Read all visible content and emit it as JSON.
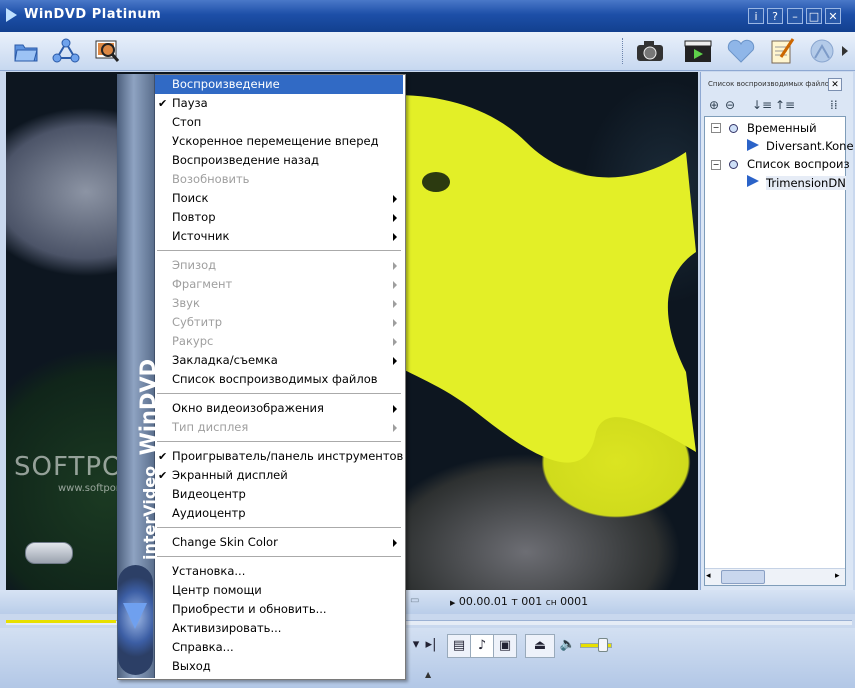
{
  "window": {
    "title": "WinDVD Platinum",
    "controls": [
      "i",
      "?",
      "–",
      "□",
      "✕"
    ]
  },
  "toolbar": {
    "left": [
      "open-icon",
      "network-icon",
      "search-icon"
    ],
    "right": [
      "camera-icon",
      "clapper-icon",
      "heart-icon",
      "notepad-icon",
      "satellite-icon"
    ]
  },
  "watermark": {
    "text": "SOFTPORTAL",
    "url": "www.softportal.com"
  },
  "playlist": {
    "title": "Список воспроизводимых файлов",
    "nodes": [
      {
        "label": "Временный",
        "level": 0
      },
      {
        "label": "Diversant.Kone",
        "level": 1
      },
      {
        "label": "Список воспроиз",
        "level": 0
      },
      {
        "label": "TrimensionDN",
        "level": 1
      }
    ]
  },
  "status": {
    "time": "00.00.01",
    "title_prefix": "т",
    "title_num": "001",
    "chapter_prefix": "сн",
    "chapter_num": "0001"
  },
  "menu": {
    "side_brand": "WinDVD",
    "side_vendor": "interVideo",
    "items": [
      {
        "label": "Воспроизведение",
        "highlight": true
      },
      {
        "label": "Пауза",
        "checked": true
      },
      {
        "label": "Стоп"
      },
      {
        "label": "Ускоренное перемещение вперед"
      },
      {
        "label": "Воспроизведение назад"
      },
      {
        "label": "Возобновить",
        "disabled": true
      },
      {
        "label": "Поиск",
        "submenu": true
      },
      {
        "label": "Повтор",
        "submenu": true
      },
      {
        "label": "Источник",
        "submenu": true
      },
      {
        "separator": true
      },
      {
        "label": "Эпизод",
        "disabled": true,
        "submenu": true
      },
      {
        "label": "Фрагмент",
        "disabled": true,
        "submenu": true
      },
      {
        "label": "Звук",
        "disabled": true,
        "submenu": true
      },
      {
        "label": "Субтитр",
        "disabled": true,
        "submenu": true
      },
      {
        "label": "Ракурс",
        "disabled": true,
        "submenu": true
      },
      {
        "label": "Закладка/съемка",
        "submenu": true
      },
      {
        "label": "Список воспроизводимых файлов"
      },
      {
        "separator": true
      },
      {
        "label": "Окно видеоизображения",
        "submenu": true
      },
      {
        "label": "Тип дисплея",
        "disabled": true,
        "submenu": true
      },
      {
        "separator": true
      },
      {
        "label": "Проигрыватель/панель инструментов",
        "checked": true
      },
      {
        "label": "Экранный дисплей",
        "checked": true
      },
      {
        "label": "Видеоцентр"
      },
      {
        "label": "Аудиоцентр"
      },
      {
        "separator": true
      },
      {
        "label": "Change Skin Color",
        "submenu": true
      },
      {
        "separator": true
      },
      {
        "label": "Установка..."
      },
      {
        "label": "Центр помощи"
      },
      {
        "label": "Приобрести и обновить..."
      },
      {
        "label": "Активизировать..."
      },
      {
        "label": "Справка..."
      },
      {
        "label": "Выход"
      }
    ]
  },
  "colors": {
    "titlebar": "#1d4fa8",
    "highlight": "#316ac5",
    "fish": "#e6f22a",
    "progress": "#e8e000"
  }
}
